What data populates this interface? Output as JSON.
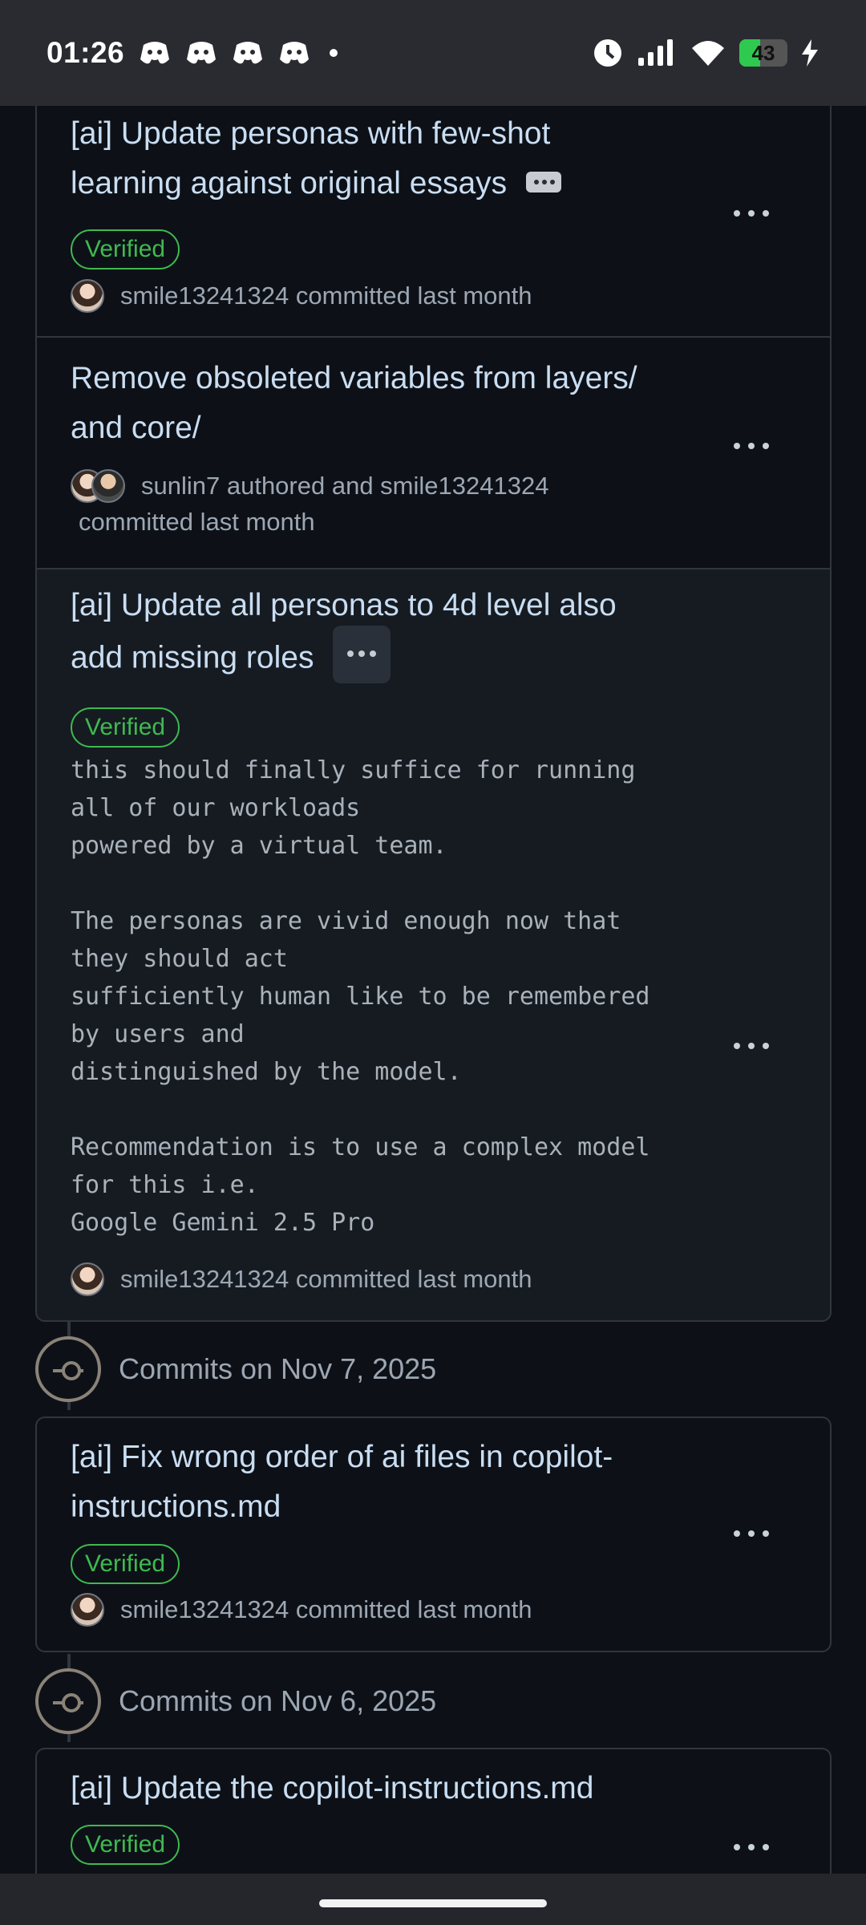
{
  "status_bar": {
    "time": "01:26",
    "notification_icons": [
      "discord-icon",
      "discord-icon",
      "discord-icon",
      "discord-icon"
    ],
    "battery_level": "43",
    "battery_fraction": 0.43
  },
  "commit_groups": [
    {
      "date_label": "Commits on Nov 7, 2025"
    },
    {
      "date_label": "Commits on Nov 6, 2025"
    }
  ],
  "commits": [
    {
      "title_line1": "[ai] Update personas with few-shot",
      "title_line2": "learning against original essays",
      "badge": "Verified",
      "meta": "smile13241324 committed last month"
    },
    {
      "title_line1": "Remove obsoleted variables from layers/",
      "title_line2": "and core/",
      "meta": "sunlin7 authored and smile13241324",
      "meta_line2": "committed last month"
    },
    {
      "title_line1": "[ai] Update all personas to 4d level also",
      "title_line2": "add missing roles",
      "badge": "Verified",
      "body": "this should finally suffice for running\nall of our workloads\npowered by a virtual team.\n\nThe personas are vivid enough now that\nthey should act\nsufficiently human like to be remembered\nby users and\ndistinguished by the model.\n\nRecommendation is to use a complex model\nfor this i.e.\nGoogle Gemini 2.5 Pro",
      "meta": "smile13241324 committed last month"
    },
    {
      "title_line1": "[ai] Fix wrong order of ai files in copilot-",
      "title_line2": "instructions.md",
      "badge": "Verified",
      "meta": "smile13241324 committed last month"
    },
    {
      "title_line1": "[ai] Update the copilot-instructions.md",
      "badge": "Verified"
    }
  ]
}
